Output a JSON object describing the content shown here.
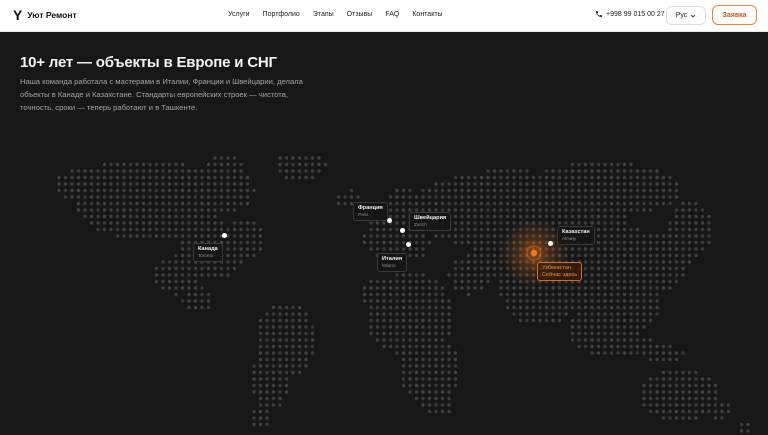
{
  "header": {
    "brand": "Уют Ремонт",
    "logo_letter": "Y",
    "nav": [
      "Услуги",
      "Портфолио",
      "Этапы",
      "Отзывы",
      "FAQ",
      "Контакты"
    ],
    "phone": "+998 99 015 00 27",
    "language": "Рус",
    "cta_label": "Заявка"
  },
  "hero": {
    "title": "10+ лет — объекты в Европе и СНГ",
    "description": "Наша команда работала с мастерами в Италии, Франции и Швейцарии, делала объекты в Канаде и Казахстане. Стандарты европейских строек — чистота, точность, сроки — теперь работают и в Ташкенте."
  },
  "map": {
    "accent_color": "#e8731f",
    "locations": [
      {
        "country": "Канада",
        "city": "Toronto"
      },
      {
        "country": "Франция",
        "city": "Paris"
      },
      {
        "country": "Швейцария",
        "city": "Zurich"
      },
      {
        "country": "Италия",
        "city": "Milano"
      },
      {
        "country": "Казахстан",
        "city": "Almaty"
      },
      {
        "country": "Узбекистан",
        "city": "Сейчас здесь"
      }
    ]
  }
}
